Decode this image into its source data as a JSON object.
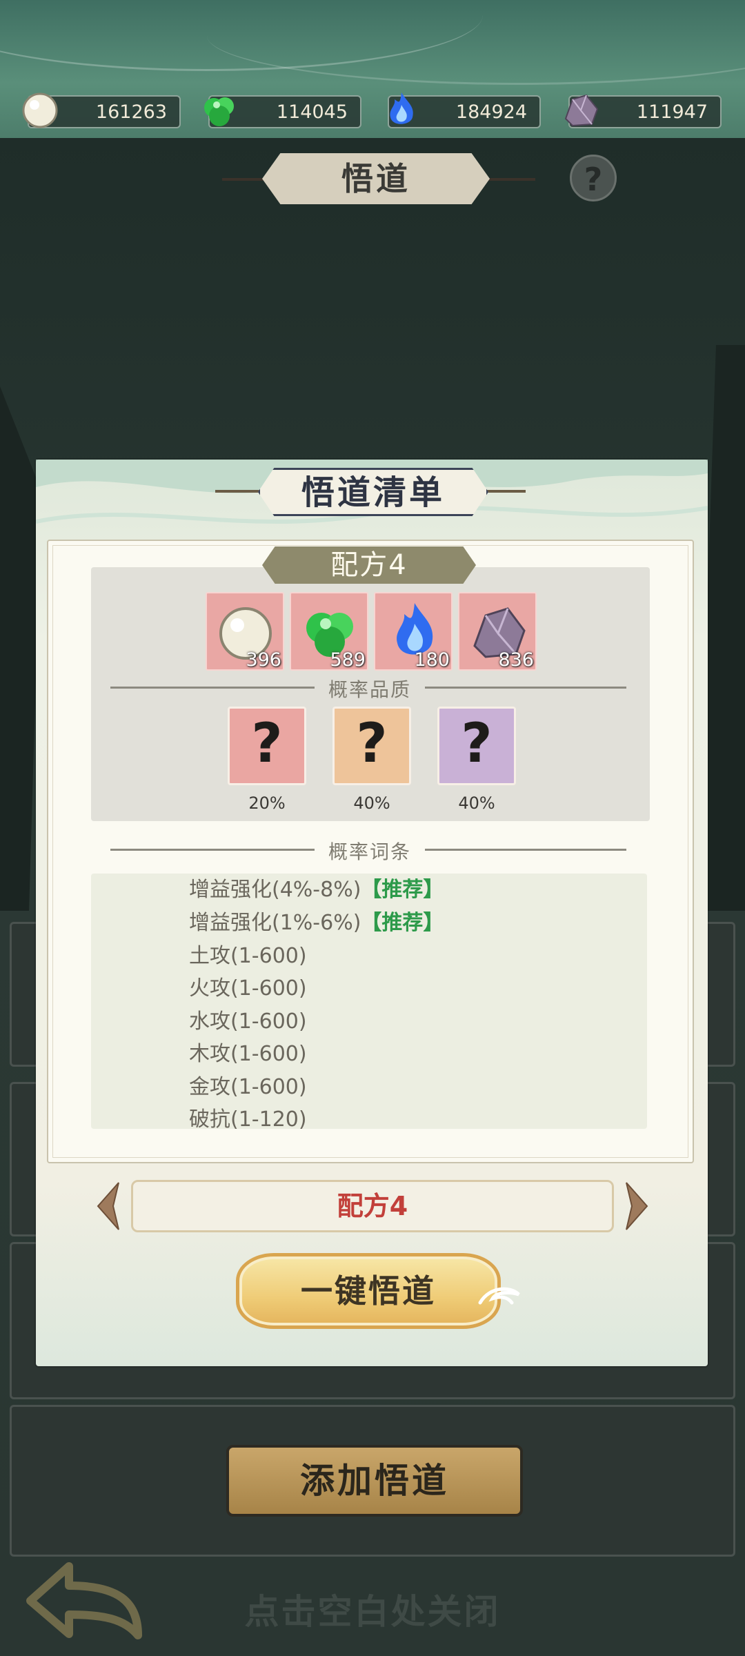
{
  "resources": [
    {
      "icon": "pearl-icon",
      "value": "161263"
    },
    {
      "icon": "green-jade-icon",
      "value": "114045"
    },
    {
      "icon": "blue-flame-icon",
      "value": "184924"
    },
    {
      "icon": "purple-ore-icon",
      "value": "111947"
    }
  ],
  "header": {
    "title": "悟道",
    "help_label": "?"
  },
  "modal": {
    "title": "悟道清单",
    "recipe_tag": "配方4",
    "ingredients": [
      {
        "icon": "pearl-icon",
        "count": "396"
      },
      {
        "icon": "green-jade-icon",
        "count": "589"
      },
      {
        "icon": "blue-flame-icon",
        "count": "180"
      },
      {
        "icon": "purple-ore-icon",
        "count": "836"
      }
    ],
    "quality_section_label": "概率品质",
    "qualities": [
      {
        "label": "?",
        "percent": "20%",
        "color": "#eaa6a2"
      },
      {
        "label": "?",
        "percent": "40%",
        "color": "#eec49a"
      },
      {
        "label": "?",
        "percent": "40%",
        "color": "#c9b1d6"
      }
    ],
    "entries_section_label": "概率词条",
    "entries": [
      {
        "text": "增益强化(4%-8%)",
        "tag": "【推荐】"
      },
      {
        "text": "增益强化(1%-6%)",
        "tag": "【推荐】"
      },
      {
        "text": "土攻(1-600)",
        "tag": ""
      },
      {
        "text": "火攻(1-600)",
        "tag": ""
      },
      {
        "text": "水攻(1-600)",
        "tag": ""
      },
      {
        "text": "木攻(1-600)",
        "tag": ""
      },
      {
        "text": "金攻(1-600)",
        "tag": ""
      },
      {
        "text": "破抗(1-120)",
        "tag": ""
      }
    ],
    "recipe_select_value": "配方4",
    "main_button_label": "一键悟道"
  },
  "background": {
    "add_button_label": "添加悟道",
    "close_hint": "点击空白处关闭"
  },
  "colors": {
    "recommend_green": "#2d9a4a",
    "recipe_red": "#c2403a",
    "gold_button": "#efcc77"
  }
}
